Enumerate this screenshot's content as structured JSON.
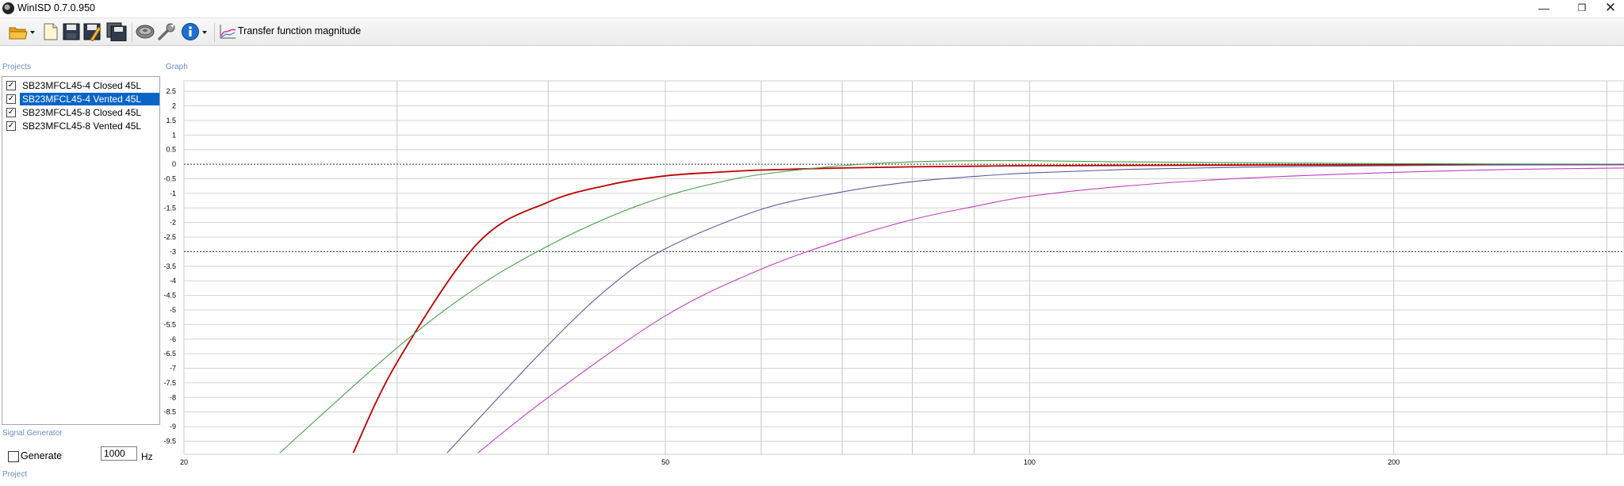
{
  "window": {
    "title": "WinISD 0.7.0.950",
    "minimize": "—",
    "maximize": "❐",
    "close": "✕"
  },
  "toolbar": {
    "buttons": [
      {
        "name": "open-project-icon"
      },
      {
        "name": "new-project-icon"
      },
      {
        "name": "save-icon"
      },
      {
        "name": "save-as-icon"
      },
      {
        "name": "save-all-icon"
      },
      {
        "name": "driver-editor-icon"
      },
      {
        "name": "tools-icon"
      },
      {
        "name": "info-icon"
      }
    ],
    "graph_select_label": "Transfer function magnitude"
  },
  "sections": {
    "projects": "Projects",
    "graph": "Graph",
    "signal_generator": "Signal Generator",
    "project": "Project"
  },
  "projects": [
    {
      "label": "SB23MFCL45-4  Closed 45L",
      "checked": true,
      "selected": false
    },
    {
      "label": "SB23MFCL45-4 Vented 45L",
      "checked": true,
      "selected": true
    },
    {
      "label": "SB23MFCL45-8 Closed 45L",
      "checked": true,
      "selected": false
    },
    {
      "label": "SB23MFCL45-8 Vented 45L",
      "checked": true,
      "selected": false
    }
  ],
  "signal_generator": {
    "generate_label": "Generate",
    "generate_checked": false,
    "frequency": "1000",
    "unit": "Hz"
  },
  "chart_data": {
    "type": "line",
    "title": "",
    "xlabel": "",
    "ylabel": "",
    "x_scale": "log",
    "xlim": [
      20,
      310
    ],
    "ylim": [
      -9.95,
      2.75
    ],
    "x_tick_labels": [
      {
        "value": 20,
        "label": "20"
      },
      {
        "value": 50,
        "label": "50"
      },
      {
        "value": 100,
        "label": "100"
      },
      {
        "value": 200,
        "label": "200"
      }
    ],
    "x_gridlines": [
      30,
      40,
      50,
      60,
      70,
      80,
      90,
      100,
      200,
      300
    ],
    "y_ticks": [
      2.5,
      2,
      1.5,
      1,
      0.5,
      0,
      -0.5,
      -1,
      -1.5,
      -2,
      -2.5,
      -3,
      -3.5,
      -4,
      -4.5,
      -5,
      -5.5,
      -6,
      -6.5,
      -7,
      -7.5,
      -8,
      -8.5,
      -9,
      -9.5
    ],
    "reference_lines": [
      0,
      -3
    ],
    "grid": true,
    "series": [
      {
        "color": "#c00000",
        "x": [
          27.6,
          30,
          35,
          40,
          45,
          50,
          55,
          60,
          70,
          80,
          90,
          100,
          150,
          200,
          310
        ],
        "y": [
          -9.9,
          -6.8,
          -2.7,
          -1.3,
          -0.7,
          -0.4,
          -0.28,
          -0.2,
          -0.13,
          -0.09,
          -0.07,
          -0.05,
          -0.03,
          -0.02,
          -0.01
        ]
      },
      {
        "color": "#4aa04a",
        "x": [
          24,
          30,
          35,
          40,
          45,
          50,
          55,
          60,
          70,
          80,
          90,
          100,
          120,
          150,
          200,
          310
        ],
        "y": [
          -9.9,
          -6.3,
          -4.2,
          -2.8,
          -1.8,
          -1.1,
          -0.65,
          -0.35,
          -0.05,
          0.08,
          0.12,
          0.12,
          0.08,
          0.05,
          0.02,
          0.0
        ]
      },
      {
        "color": "#5a5aa0",
        "x": [
          33,
          40,
          45,
          50,
          60,
          70,
          80,
          90,
          100,
          120,
          150,
          200,
          250,
          310
        ],
        "y": [
          -9.9,
          -6.2,
          -4.2,
          -2.9,
          -1.55,
          -0.95,
          -0.6,
          -0.42,
          -0.3,
          -0.18,
          -0.1,
          -0.05,
          -0.02,
          -0.01
        ]
      },
      {
        "color": "#c040c0",
        "x": [
          35,
          40,
          50,
          60,
          70,
          80,
          90,
          100,
          120,
          150,
          200,
          250,
          310
        ],
        "y": [
          -9.9,
          -8.0,
          -5.2,
          -3.6,
          -2.6,
          -1.9,
          -1.45,
          -1.1,
          -0.75,
          -0.48,
          -0.28,
          -0.18,
          -0.13
        ]
      }
    ]
  }
}
